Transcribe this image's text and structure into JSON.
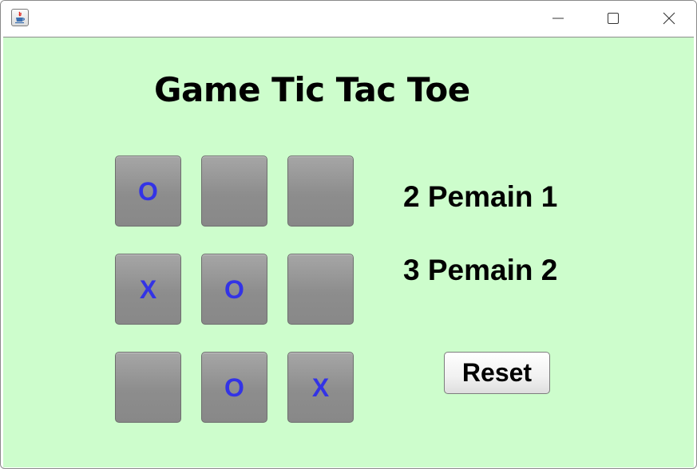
{
  "window": {
    "icon": "java-coffee-cup-icon",
    "controls": [
      "minimize-icon",
      "maximize-icon",
      "close-icon"
    ]
  },
  "game": {
    "title": "Game Tic Tac Toe",
    "board": {
      "cells": [
        "O",
        "",
        "",
        "X",
        "O",
        "",
        "",
        "O",
        "X"
      ]
    },
    "scores": {
      "player1": "2 Pemain 1",
      "player2": "3 Pemain 2"
    },
    "reset_label": "Reset"
  },
  "colors": {
    "background": "#cdfdcc",
    "mark": "#3333e6",
    "cell": "#8d8d8d"
  }
}
